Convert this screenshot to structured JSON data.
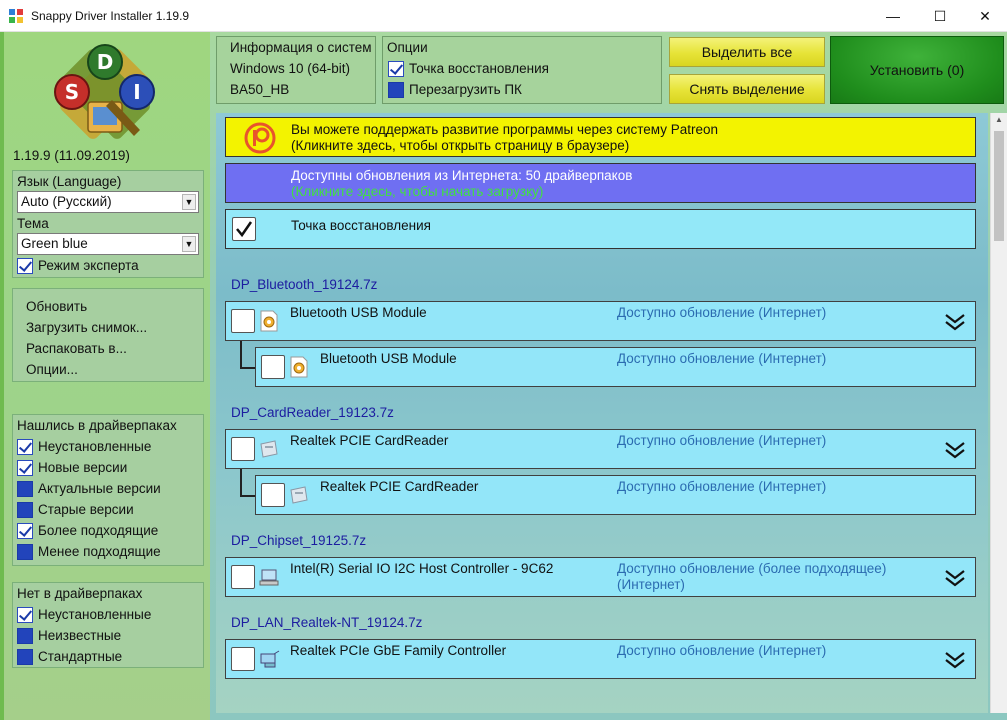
{
  "window": {
    "title": "Snappy Driver Installer 1.19.9",
    "min_glyph": "—",
    "max_glyph": "☐",
    "close_glyph": "✕"
  },
  "logo": {
    "letters": [
      "D",
      "S",
      "I"
    ]
  },
  "version_text": "1.19.9 (11.09.2019)",
  "settings": {
    "language_label": "Язык (Language)",
    "language_value": "Auto (Русский)",
    "theme_label": "Тема",
    "theme_value": "Green blue",
    "expert_mode_label": "Режим эксперта",
    "expert_mode_checked": true
  },
  "actions": {
    "items": [
      "Обновить",
      "Загрузить снимок...",
      "Распаковать в...",
      "Опции..."
    ]
  },
  "found_filter": {
    "title": "Нашлись в драйверпаках",
    "items": [
      {
        "label": "Неустановленные",
        "checked": true
      },
      {
        "label": "Новые версии",
        "checked": true
      },
      {
        "label": "Актуальные версии",
        "checked": false
      },
      {
        "label": "Старые версии",
        "checked": false
      },
      {
        "label": "Более подходящие",
        "checked": true
      },
      {
        "label": "Менее подходящие",
        "checked": false
      }
    ]
  },
  "missing_filter": {
    "title": "Нет в драйверпаках",
    "items": [
      {
        "label": "Неустановленные",
        "checked": true
      },
      {
        "label": "Неизвестные",
        "checked": false
      },
      {
        "label": "Стандартные",
        "checked": false
      }
    ]
  },
  "sysinfo": {
    "title": "Информация о систем",
    "os": "Windows 10 (64-bit)",
    "board": "BA50_HB"
  },
  "options": {
    "title": "Опции",
    "restore_point_label": "Точка восстановления",
    "restore_point_checked": true,
    "reboot_label": "Перезагрузить ПК",
    "reboot_checked": false
  },
  "buttons": {
    "select_all": "Выделить все",
    "deselect": "Снять выделение",
    "install": "Установить (0)"
  },
  "banners": {
    "patreon_line1": "Вы можете поддержать развитие программы через систему Patreon",
    "patreon_line2": "(Кликните здесь, чтобы открыть страницу в браузере)",
    "updates_line1": "Доступны обновления из Интернета: 50 драйверпаков",
    "updates_line2": "(Кликните здесь, чтобы начать загрузку)",
    "restore_point": "Точка восстановления"
  },
  "colors": {
    "patreon_banner": "#f3f300",
    "updates_banner": "#6f6ff2",
    "driver_row": "#93e6f9",
    "status_text": "#2b6bb0",
    "group_title": "#1c1ca0",
    "install_button": "#1f8d1c"
  },
  "driver_groups": [
    {
      "pack": "DP_Bluetooth_19124.7z",
      "driver": {
        "name": "Bluetooth USB Module",
        "status": "Доступно обновление (Интернет)",
        "icon": "gear-icon"
      },
      "child": {
        "name": "Bluetooth USB Module",
        "status": "Доступно обновление (Интернет)",
        "icon": "gear-icon"
      }
    },
    {
      "pack": "DP_CardReader_19123.7z",
      "driver": {
        "name": "Realtek PCIE CardReader",
        "status": "Доступно обновление (Интернет)",
        "icon": "card-reader-icon"
      },
      "child": {
        "name": "Realtek PCIE CardReader",
        "status": "Доступно обновление (Интернет)",
        "icon": "card-reader-icon"
      }
    },
    {
      "pack": "DP_Chipset_19125.7z",
      "driver": {
        "name": "Intel(R) Serial IO I2C Host Controller - 9C62",
        "status": "Доступно обновление (более подходящее) (Интернет)",
        "icon": "computer-icon"
      }
    },
    {
      "pack": "DP_LAN_Realtek-NT_19124.7z",
      "driver": {
        "name": "Realtek PCIe GbE Family Controller",
        "status": "Доступно обновление (Интернет)",
        "icon": "network-icon"
      }
    }
  ]
}
